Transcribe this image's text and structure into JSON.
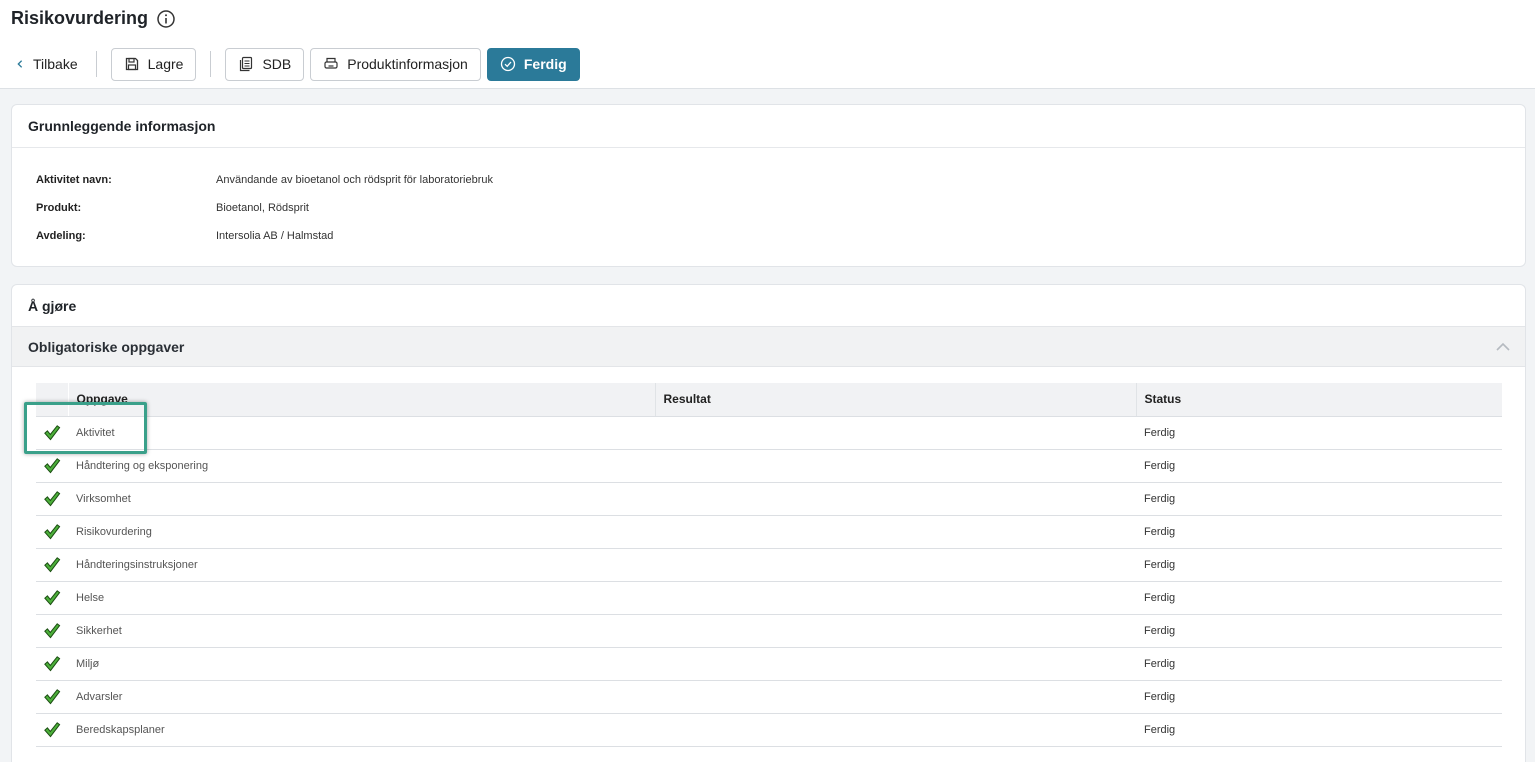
{
  "page": {
    "title": "Risikovurdering",
    "info_icon": "info-circle-icon"
  },
  "toolbar": {
    "back_label": "Tilbake",
    "save_label": "Lagre",
    "sdb_label": "SDB",
    "product_info_label": "Produktinformasjon",
    "done_label": "Ferdig",
    "primary_color": "#2b7a99"
  },
  "basic_info": {
    "header": "Grunnleggende informasjon",
    "rows": [
      {
        "label": "Aktivitet navn:",
        "value": "Användande av bioetanol och rödsprit för laboratoriebruk"
      },
      {
        "label": "Produkt:",
        "value": "Bioetanol, Rödsprit"
      },
      {
        "label": "Avdeling:",
        "value": "Intersolia AB / Halmstad"
      }
    ]
  },
  "todo": {
    "header": "Å gjøre",
    "accordion_title": "Obligatoriske oppgaver",
    "accordion_icon": "chevron-up-icon",
    "columns": [
      "Oppgave",
      "Resultat",
      "Status"
    ],
    "tasks": [
      {
        "name": "Aktivitet",
        "result": "",
        "status": "Ferdig"
      },
      {
        "name": "Håndtering og eksponering",
        "result": "",
        "status": "Ferdig"
      },
      {
        "name": "Virksomhet",
        "result": "",
        "status": "Ferdig"
      },
      {
        "name": "Risikovurdering",
        "result": "",
        "status": "Ferdig"
      },
      {
        "name": "Håndteringsinstruksjoner",
        "result": "",
        "status": "Ferdig"
      },
      {
        "name": "Helse",
        "result": "",
        "status": "Ferdig"
      },
      {
        "name": "Sikkerhet",
        "result": "",
        "status": "Ferdig"
      },
      {
        "name": "Miljø",
        "result": "",
        "status": "Ferdig"
      },
      {
        "name": "Advarsler",
        "result": "",
        "status": "Ferdig"
      },
      {
        "name": "Beredskapsplaner",
        "result": "",
        "status": "Ferdig"
      }
    ],
    "highlight_color": "#3aa08a",
    "check_color": "#3c9a2f"
  }
}
